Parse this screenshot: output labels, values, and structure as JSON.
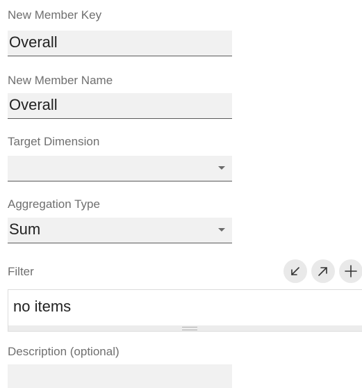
{
  "form": {
    "new_member_key": {
      "label": "New Member Key",
      "value": "Overall"
    },
    "new_member_name": {
      "label": "New Member Name",
      "value": "Overall"
    },
    "target_dimension": {
      "label": "Target Dimension",
      "value": ""
    },
    "aggregation_type": {
      "label": "Aggregation Type",
      "value": "Sum"
    },
    "filter": {
      "label": "Filter",
      "empty_text": "no items",
      "actions": [
        {
          "icon": "collapse-arrow-icon"
        },
        {
          "icon": "expand-arrow-icon"
        },
        {
          "icon": "plus-icon"
        }
      ]
    },
    "description": {
      "label": "Description (optional)",
      "value": ""
    }
  },
  "colors": {
    "label_text": "#6f6f6f",
    "field_bg": "#f1f1f1",
    "field_underline": "#5a5a5a",
    "icon_button_bg": "#e9e9e9"
  }
}
